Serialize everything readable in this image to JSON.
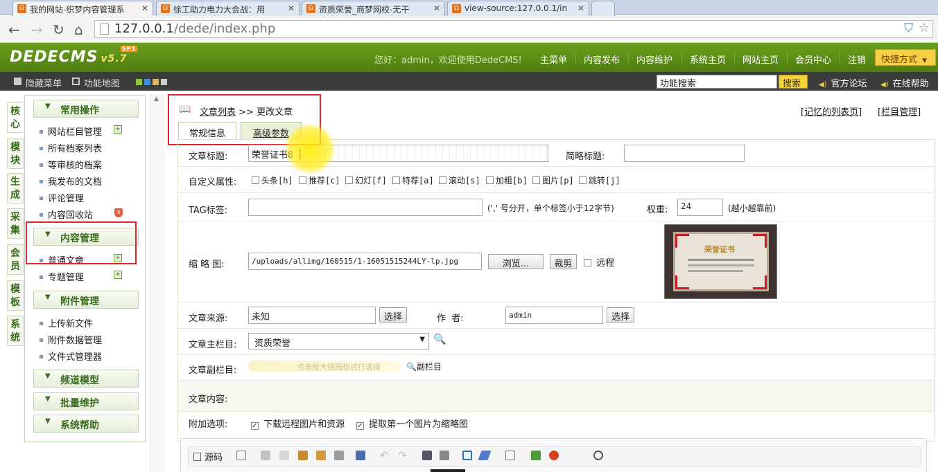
{
  "browser": {
    "tabs": [
      {
        "label": "我的网站-织梦内容管理系",
        "active": true
      },
      {
        "label": "徐工助力电力大会战：用",
        "active": false
      },
      {
        "label": "资质荣誉_商梦网校-无干",
        "active": false
      },
      {
        "label": "view-source:127.0.0.1/in",
        "active": false
      }
    ],
    "url_host": "127.0.0.1",
    "url_path": "/dede/index.php"
  },
  "header": {
    "logo": "DEDECMS",
    "version": "v5.7",
    "badge": "SP1",
    "welcome": "您好：admin，欢迎使用DedeCMS!",
    "nav": [
      "主菜单",
      "内容发布",
      "内容维护",
      "系统主页",
      "网站主页",
      "会员中心",
      "注销"
    ],
    "quick": "快捷方式"
  },
  "toolbar": {
    "hide_menu": "隐藏菜单",
    "func_map": "功能地图",
    "search_value": "功能搜索",
    "search_button": "搜索",
    "forum": "官方论坛",
    "help": "在线帮助"
  },
  "side_tabs": [
    "核心",
    "模块",
    "生成",
    "采集",
    "会员",
    "模板",
    "系统"
  ],
  "menu": {
    "common": {
      "title": "常用操作",
      "items": [
        "网站栏目管理",
        "所有档案列表",
        "等审核的档案",
        "我发布的文档",
        "评论管理",
        "内容回收站"
      ]
    },
    "content": {
      "title": "内容管理",
      "items": [
        "普通文章",
        "专题管理"
      ]
    },
    "attach": {
      "title": "附件管理",
      "items": [
        "上传新文件",
        "附件数据管理",
        "文件式管理器"
      ]
    },
    "channel": "频道模型",
    "batch": "批量维护",
    "sys_help": "系统帮助"
  },
  "main": {
    "crumb_link": "文章列表",
    "crumb_sep": ">>",
    "crumb_current": "更改文章",
    "remember_list": "[记忆的列表页]",
    "column_manage": "[栏目管理]",
    "tab_basic": "常规信息",
    "tab_advanced": "高级参数"
  },
  "form": {
    "title_label": "文章标题:",
    "title_value": "荣誉证书8",
    "short_label": "简略标题:",
    "attr_label": "自定义属性:",
    "attrs": [
      "头条[h]",
      "推荐[c]",
      "幻灯[f]",
      "特荐[a]",
      "滚动[s]",
      "加粗[b]",
      "图片[p]",
      "跳转[j]"
    ],
    "tag_label": "TAG标签:",
    "tag_hint": "(',' 号分开，单个标签小于12字节)",
    "weight_label": "权重:",
    "weight_value": "24",
    "weight_hint": "(越小越靠前)",
    "thumb_label": "缩 略 图:",
    "thumb_value": "/uploads/allimg/160515/1-16051515244LY-lp.jpg",
    "browse": "浏览...",
    "crop": "裁剪",
    "remote": "远程",
    "thumb_text": "荣誉证书",
    "source_label": "文章来源:",
    "source_value": "未知",
    "select": "选择",
    "author_label": "作  者:",
    "author_value": "admin",
    "main_col_label": "文章主栏目:",
    "main_col_value": "资质荣誉",
    "sub_col_label": "文章副栏目:",
    "sub_col_hint": "点击放大镜图标进行选择",
    "sub_col_link": "副栏目",
    "content_label": "文章内容:",
    "extra_label": "附加选项:",
    "extra1": "下载远程图片和资源",
    "extra2": "提取第一个图片为缩略图",
    "editor_source": "源码"
  },
  "colors": {
    "header_green": "#5a8c15",
    "accent_yellow": "#f5d23d",
    "highlight_red": "#e0242b"
  }
}
